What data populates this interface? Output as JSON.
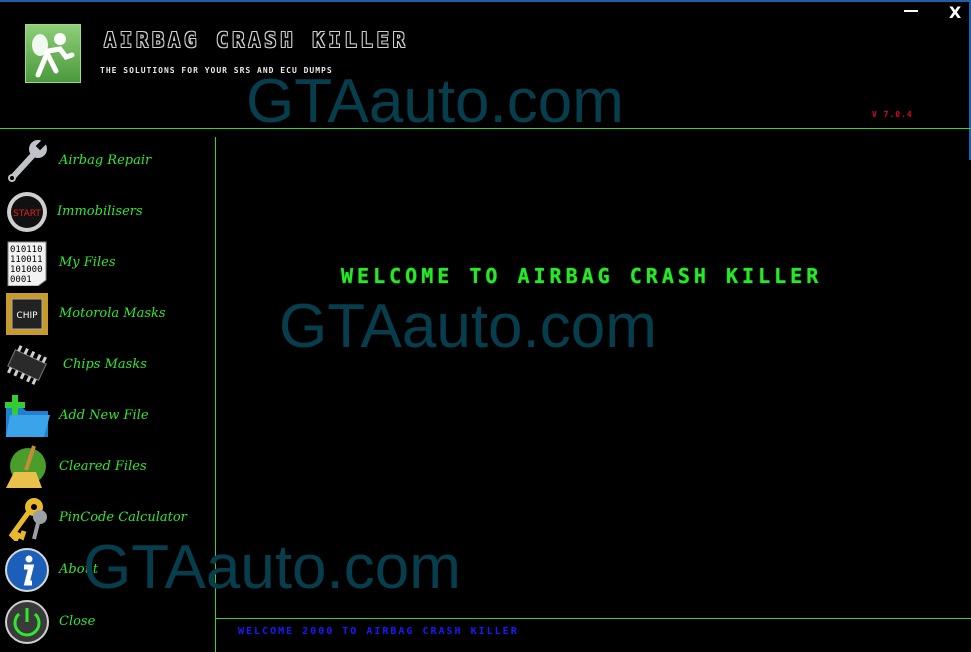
{
  "header": {
    "title": "AIRBAG CRASH KILLER",
    "subtitle": "THE SOLUTIONS FOR YOUR SRS AND ECU DUMPS",
    "version": "V 7.0.4",
    "close_label": "X"
  },
  "sidebar": {
    "items": [
      {
        "label": "Airbag Repair",
        "icon": "wrench-icon"
      },
      {
        "label": "Immobilisers",
        "icon": "start-button-icon"
      },
      {
        "label": "My Files",
        "icon": "binary-file-icon"
      },
      {
        "label": "Motorola Masks",
        "icon": "cpu-chip-icon"
      },
      {
        "label": "Chips Masks",
        "icon": "ic-chip-icon"
      },
      {
        "label": "Add New File",
        "icon": "add-folder-icon"
      },
      {
        "label": "Cleared Files",
        "icon": "broom-icon"
      },
      {
        "label": "PinCode Calculator",
        "icon": "keys-icon"
      },
      {
        "label": "About",
        "icon": "info-icon"
      },
      {
        "label": "Close",
        "icon": "power-icon"
      }
    ]
  },
  "main": {
    "welcome": "WELCOME TO AIRBAG CRASH KILLER"
  },
  "status": {
    "text": "WELCOME 2000 TO AIRBAG CRASH KILLER"
  },
  "watermark": "GTAauto.com",
  "colors": {
    "accent_green": "#31e631",
    "status_blue": "#1a1aff",
    "version_red": "#e0002a",
    "background": "#000000"
  }
}
